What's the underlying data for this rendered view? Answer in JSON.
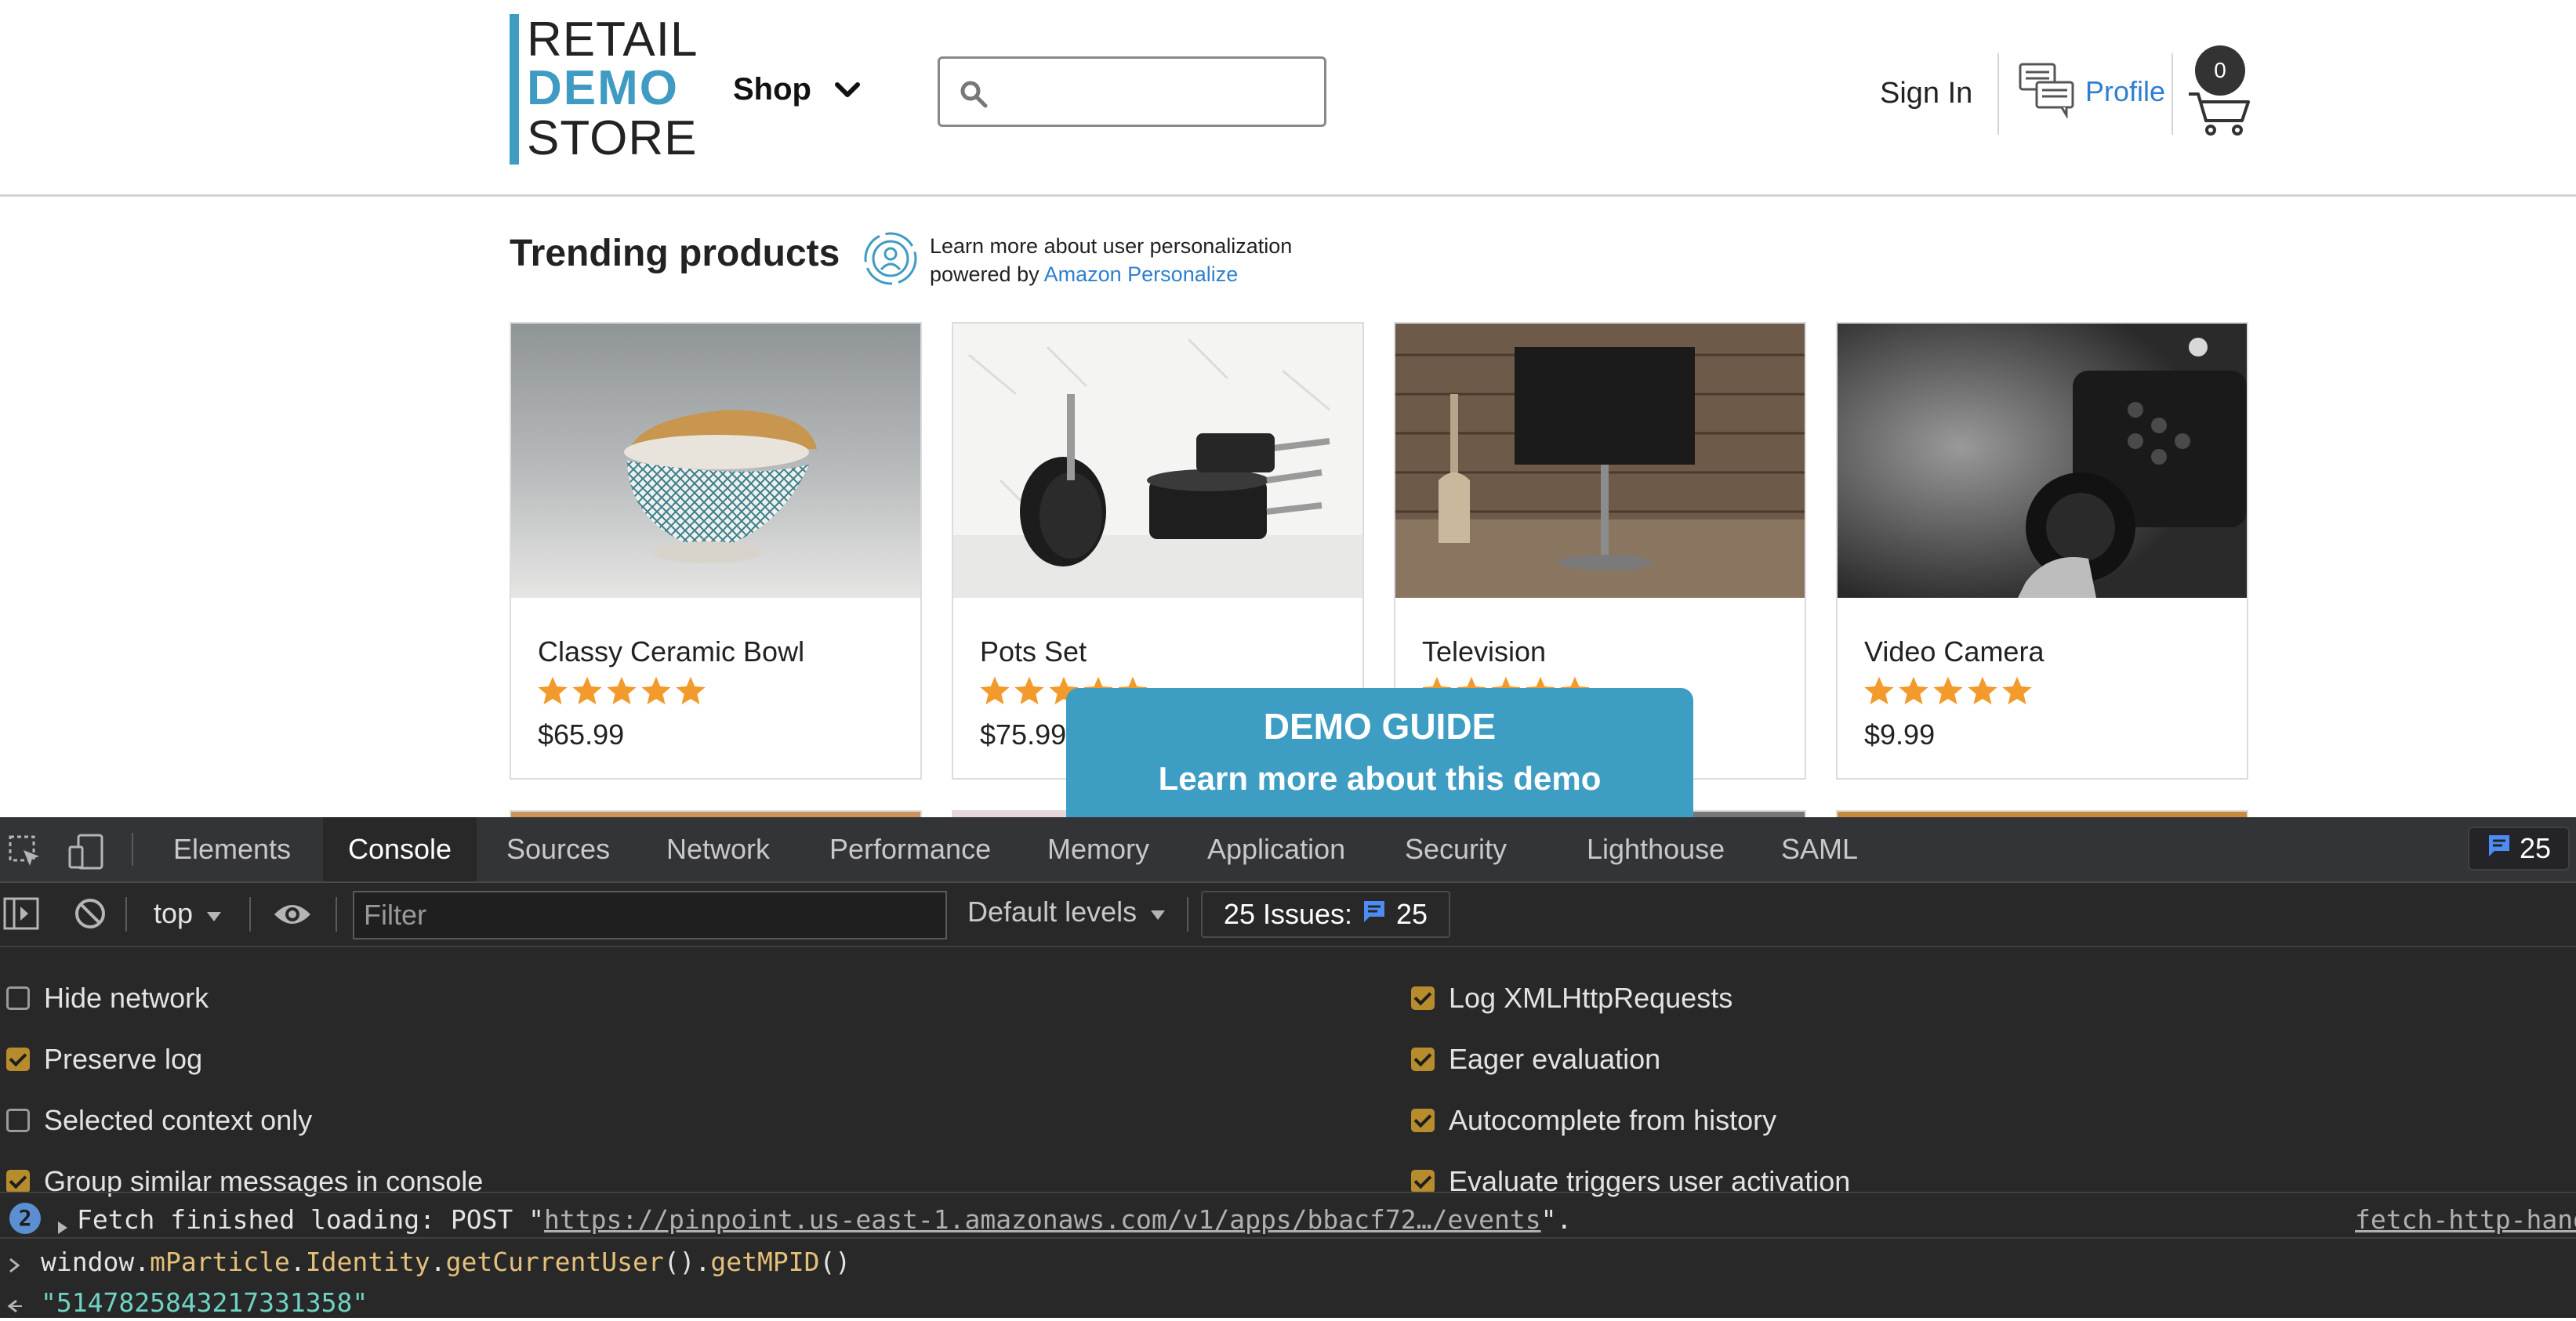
{
  "store": {
    "logo": {
      "line1": "RETAIL",
      "line2": "DEMO",
      "line3": "STORE"
    },
    "nav": {
      "shop_label": "Shop"
    },
    "search": {
      "placeholder": ""
    },
    "header": {
      "sign_in": "Sign In",
      "profile": "Profile",
      "cart_count": "0"
    },
    "trending": {
      "title": "Trending products",
      "personalize_line1": "Learn more about user personalization",
      "personalize_prefix": "powered by ",
      "personalize_link": "Amazon Personalize"
    },
    "products": [
      {
        "name": "Classy Ceramic Bowl",
        "rating": 5,
        "price": "$65.99"
      },
      {
        "name": "Pots Set",
        "rating": 5,
        "price": "$75.99"
      },
      {
        "name": "Television",
        "rating": 5,
        "price": ""
      },
      {
        "name": "Video Camera",
        "rating": 5,
        "price": "$9.99"
      }
    ],
    "demo_guide": {
      "title": "DEMO GUIDE",
      "subtitle": "Learn more about this demo"
    }
  },
  "devtools": {
    "tabs": [
      "Elements",
      "Console",
      "Sources",
      "Network",
      "Performance",
      "Memory",
      "Application",
      "Security",
      "Lighthouse",
      "SAML"
    ],
    "active_tab": "Console",
    "issues_count": "25",
    "toolbar": {
      "context": "top",
      "filter_placeholder": "Filter",
      "levels": "Default levels",
      "issues_label": "25 Issues:",
      "issues_count": "25"
    },
    "settings_left": [
      {
        "label": "Hide network",
        "checked": false
      },
      {
        "label": "Preserve log",
        "checked": true
      },
      {
        "label": "Selected context only",
        "checked": false
      },
      {
        "label": "Group similar messages in console",
        "checked": true
      }
    ],
    "settings_right": [
      {
        "label": "Log XMLHttpRequests",
        "checked": true
      },
      {
        "label": "Eager evaluation",
        "checked": true
      },
      {
        "label": "Autocomplete from history",
        "checked": true
      },
      {
        "label": "Evaluate triggers user activation",
        "checked": true
      }
    ],
    "console": {
      "log_repeat": "2",
      "log_prefix": "Fetch finished loading: POST \"",
      "log_url": "https://pinpoint.us-east-1.amazonaws.com/v1/apps/bbacf72…/events",
      "log_suffix": "\".",
      "log_source": "fetch-http-hand",
      "input_parts": [
        "window.",
        "mParticle",
        ".",
        "Identity",
        ".",
        "getCurrentUser",
        "().",
        "getMPID",
        "()"
      ],
      "result": "\"5147825843217331358\""
    }
  },
  "colors": {
    "brand": "#3f9bc2",
    "link": "#2f7fd1",
    "star": "#f39a2c",
    "checkbox": "#b68c2c"
  }
}
